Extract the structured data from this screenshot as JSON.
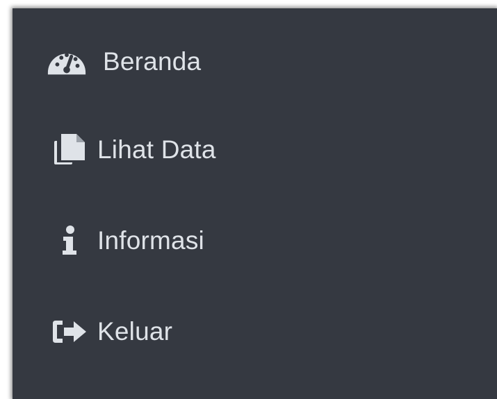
{
  "sidebar": {
    "background": "#353941",
    "text_color": "#dfe3e8",
    "items": [
      {
        "label": "Beranda",
        "icon": "dashboard-icon"
      },
      {
        "label": "Lihat Data",
        "icon": "files-icon"
      },
      {
        "label": "Informasi",
        "icon": "info-icon"
      },
      {
        "label": "Keluar",
        "icon": "sign-out-icon"
      }
    ]
  }
}
